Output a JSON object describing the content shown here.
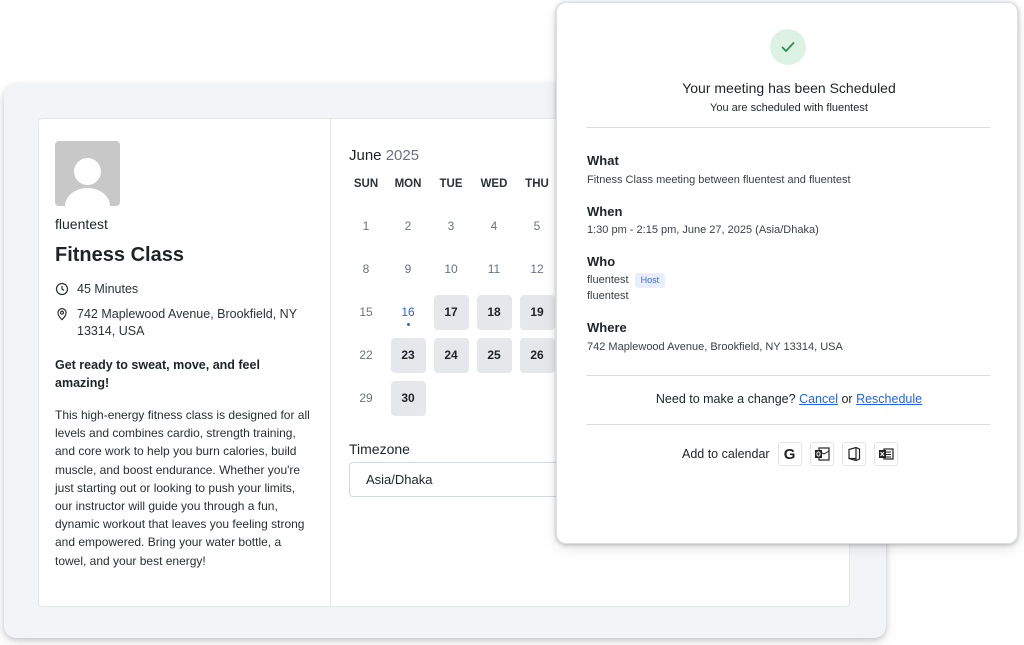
{
  "booking": {
    "host_name": "fluentest",
    "event_title": "Fitness Class",
    "duration": "45 Minutes",
    "location": "742 Maplewood Avenue, Brookfield, NY 13314, USA",
    "tagline": "Get ready to sweat, move, and feel amazing!",
    "description": "This high-energy fitness class is designed for all levels and combines cardio, strength training, and core work to help you burn calories, build muscle, and boost endurance. Whether you're just starting out or looking to push your limits, our instructor will guide you through a fun, dynamic workout that leaves you feeling strong and empowered. Bring your water bottle, a towel, and your best energy!",
    "icons": {
      "duration": "clock-icon",
      "location": "map-pin-icon"
    }
  },
  "calendar": {
    "month": "June",
    "year": "2025",
    "weekdays": [
      "SUN",
      "MON",
      "TUE",
      "WED",
      "THU"
    ],
    "weeks": [
      [
        {
          "d": "1"
        },
        {
          "d": "2"
        },
        {
          "d": "3"
        },
        {
          "d": "4"
        },
        {
          "d": "5"
        }
      ],
      [
        {
          "d": "8"
        },
        {
          "d": "9"
        },
        {
          "d": "10"
        },
        {
          "d": "11"
        },
        {
          "d": "12"
        }
      ],
      [
        {
          "d": "15"
        },
        {
          "d": "16",
          "today": true
        },
        {
          "d": "17",
          "available": true
        },
        {
          "d": "18",
          "available": true
        },
        {
          "d": "19",
          "available": true
        }
      ],
      [
        {
          "d": "22"
        },
        {
          "d": "23",
          "available": true
        },
        {
          "d": "24",
          "available": true
        },
        {
          "d": "25",
          "available": true
        },
        {
          "d": "26",
          "available": true
        }
      ],
      [
        {
          "d": "29"
        },
        {
          "d": "30",
          "available": true
        }
      ]
    ],
    "timezone_label": "Timezone",
    "timezone_value": "Asia/Dhaka"
  },
  "confirmation": {
    "title": "Your meeting has been Scheduled",
    "subtitle": "You are scheduled with fluentest",
    "what_label": "What",
    "what_value": "Fitness Class meeting between fluentest and fluentest",
    "when_label": "When",
    "when_value": "1:30 pm - 2:15 pm, June 27, 2025 (Asia/Dhaka)",
    "who_label": "Who",
    "who_host": "fluentest",
    "host_badge": "Host",
    "who_guest": "fluentest",
    "where_label": "Where",
    "where_value": "742 Maplewood Avenue, Brookfield, NY 13314, USA",
    "change_prefix": "Need to make a change?",
    "cancel_link": "Cancel",
    "or_text": "or",
    "reschedule_link": "Reschedule",
    "add_calendar_label": "Add to calendar",
    "calendar_buttons": [
      "google-calendar-icon",
      "outlook-icon",
      "office365-icon",
      "ics-download-icon"
    ],
    "google_letter": "G",
    "colors": {
      "success_bg": "#dcf2e3",
      "success_check": "#2e8b57",
      "link": "#2563eb",
      "badge_bg": "#e8eefb",
      "badge_text": "#3b6bd6"
    }
  }
}
